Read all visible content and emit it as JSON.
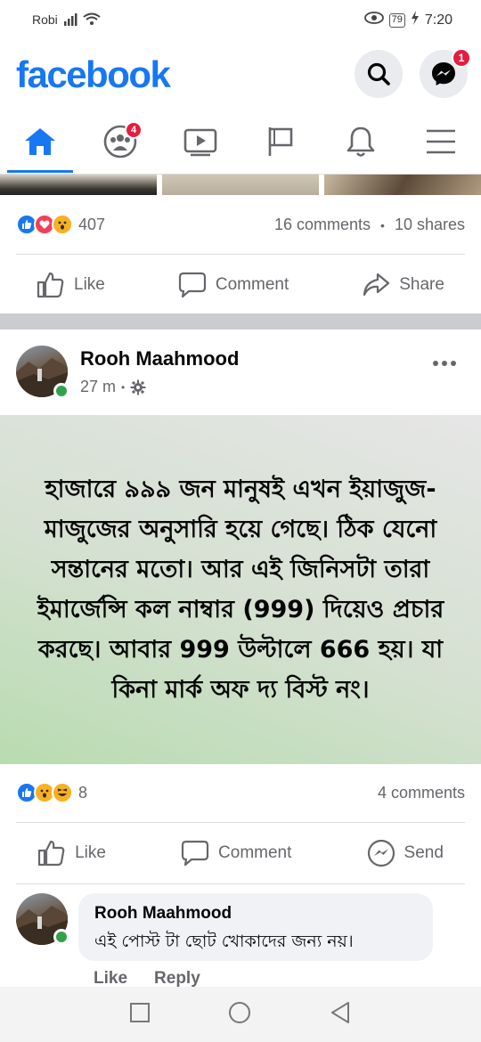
{
  "status_bar": {
    "carrier": "Robi",
    "battery": "79",
    "time": "7:20"
  },
  "header": {
    "logo": "facebook",
    "messenger_badge": "1"
  },
  "nav": {
    "groups_badge": "4"
  },
  "prev_post": {
    "reaction_count": "407",
    "comments": "16 comments",
    "dot": "•",
    "shares": "10 shares",
    "actions": {
      "like": "Like",
      "comment": "Comment",
      "share": "Share"
    }
  },
  "post": {
    "author": "Rooh Maahmood",
    "time": "27 m",
    "dot": "•",
    "text": "হাজারে ৯৯৯ জন মানুষই এখন ইয়াজুজ-মাজুজের অনুসারি হয়ে গেছে। ঠিক যেনো সন্তানের মতো। আর এই জিনিসটা তারা ইমার্জেন্সি কল নাম্বার (999) দিয়েও প্রচার করছে। আবার 999 উল্টালে 666 হয়। যা কিনা মার্ক অফ দ্য বিস্ট নং।",
    "reaction_count": "8",
    "comments": "4 comments",
    "actions": {
      "like": "Like",
      "comment": "Comment",
      "send": "Send"
    }
  },
  "comment": {
    "author": "Rooh Maahmood",
    "text": "এই পোস্ট টা ছোট খোকাদের জন্য নয়।",
    "like": "Like",
    "reply": "Reply"
  },
  "colors": {
    "brand": "#1877f2",
    "badge": "#e41e3f",
    "online": "#31a24c"
  }
}
